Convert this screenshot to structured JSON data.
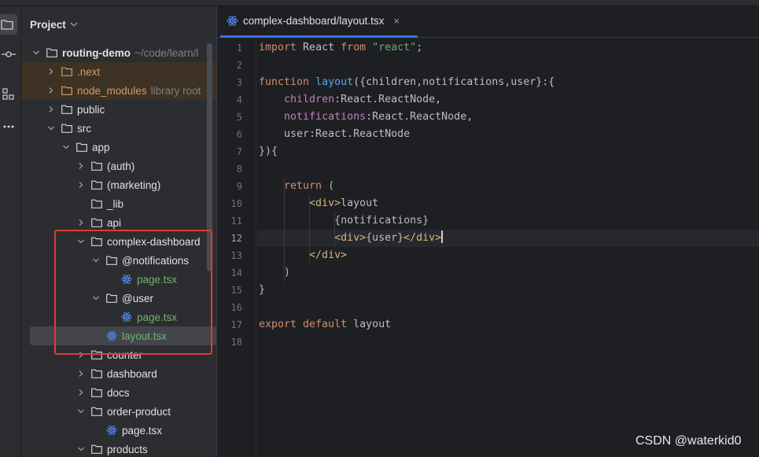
{
  "panel": {
    "title": "Project"
  },
  "tree": [
    {
      "label": "routing-demo",
      "hint": "~/code/learn/l",
      "depth": 0,
      "expanded": true,
      "type": "folder",
      "bold": true
    },
    {
      "label": ".next",
      "depth": 1,
      "expanded": false,
      "type": "folder",
      "color": "orange",
      "lib": true
    },
    {
      "label": "node_modules",
      "hint": "library root",
      "depth": 1,
      "expanded": false,
      "type": "folder",
      "color": "orange",
      "lib": true
    },
    {
      "label": "public",
      "depth": 1,
      "expanded": false,
      "type": "folder"
    },
    {
      "label": "src",
      "depth": 1,
      "expanded": true,
      "type": "folder"
    },
    {
      "label": "app",
      "depth": 2,
      "expanded": true,
      "type": "folder"
    },
    {
      "label": "(auth)",
      "depth": 3,
      "expanded": false,
      "type": "folder"
    },
    {
      "label": "(marketing)",
      "depth": 3,
      "expanded": false,
      "type": "folder"
    },
    {
      "label": "_lib",
      "depth": 3,
      "leaf": true,
      "type": "folder"
    },
    {
      "label": "api",
      "depth": 3,
      "expanded": false,
      "type": "folder"
    },
    {
      "label": "complex-dashboard",
      "depth": 3,
      "expanded": true,
      "type": "folder"
    },
    {
      "label": "@notifications",
      "depth": 4,
      "expanded": true,
      "type": "folder"
    },
    {
      "label": "page.tsx",
      "depth": 5,
      "leaf": true,
      "type": "react",
      "color": "green"
    },
    {
      "label": "@user",
      "depth": 4,
      "expanded": true,
      "type": "folder"
    },
    {
      "label": "page.tsx",
      "depth": 5,
      "leaf": true,
      "type": "react",
      "color": "green"
    },
    {
      "label": "layout.tsx",
      "depth": 4,
      "leaf": true,
      "type": "react",
      "color": "green",
      "selected": true
    },
    {
      "label": "counter",
      "depth": 3,
      "expanded": false,
      "type": "folder"
    },
    {
      "label": "dashboard",
      "depth": 3,
      "expanded": false,
      "type": "folder"
    },
    {
      "label": "docs",
      "depth": 3,
      "expanded": false,
      "type": "folder"
    },
    {
      "label": "order-product",
      "depth": 3,
      "expanded": true,
      "type": "folder"
    },
    {
      "label": "page.tsx",
      "depth": 4,
      "leaf": true,
      "type": "react"
    },
    {
      "label": "products",
      "depth": 3,
      "expanded": true,
      "type": "folder"
    }
  ],
  "editor": {
    "tab_label": "complex-dashboard/layout.tsx",
    "tab_close": "×",
    "current_line": 12,
    "lines": [
      [
        [
          "kw",
          "import"
        ],
        [
          "t",
          " React "
        ],
        [
          "kw",
          "from"
        ],
        [
          "t",
          " "
        ],
        [
          "str",
          "\"react\""
        ],
        [
          "t",
          ";"
        ]
      ],
      [],
      [
        [
          "kw",
          "function"
        ],
        [
          "t",
          " "
        ],
        [
          "fn",
          "layout"
        ],
        [
          "t",
          "({children,notifications,user}:{"
        ]
      ],
      [
        [
          "t",
          "    "
        ],
        [
          "prop",
          "children"
        ],
        [
          "t",
          ":React.ReactNode,"
        ]
      ],
      [
        [
          "t",
          "    "
        ],
        [
          "prop",
          "notifications"
        ],
        [
          "t",
          ":React.ReactNode,"
        ]
      ],
      [
        [
          "t",
          "    user:React.ReactNode"
        ]
      ],
      [
        [
          "t",
          "}){"
        ]
      ],
      [],
      [
        [
          "t",
          "    "
        ],
        [
          "kw",
          "return"
        ],
        [
          "t",
          " ("
        ]
      ],
      [
        [
          "t",
          "        "
        ],
        [
          "tag",
          "<div>"
        ],
        [
          "t",
          "layout"
        ]
      ],
      [
        [
          "t",
          "            {notifications}"
        ]
      ],
      [
        [
          "t",
          "            "
        ],
        [
          "tag",
          "<div>"
        ],
        [
          "t",
          "{user}"
        ],
        [
          "tag",
          "</div>"
        ],
        [
          "caret",
          ""
        ]
      ],
      [
        [
          "t",
          "        "
        ],
        [
          "tag",
          "</div>"
        ]
      ],
      [
        [
          "t",
          "    )"
        ]
      ],
      [
        [
          "t",
          "}"
        ]
      ],
      [],
      [
        [
          "kw",
          "export default"
        ],
        [
          "t",
          " layout"
        ]
      ],
      []
    ]
  },
  "watermark": "CSDN @waterkid0"
}
